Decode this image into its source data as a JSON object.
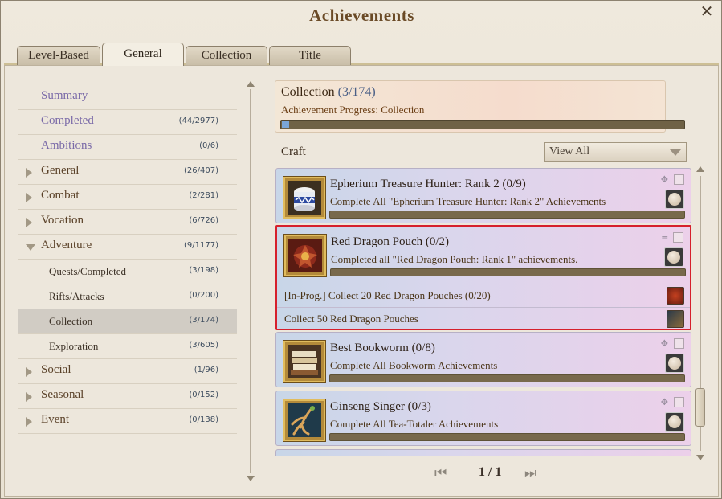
{
  "window": {
    "title": "Achievements",
    "close_glyph": "✕"
  },
  "tabs": [
    {
      "label": "Level-Based"
    },
    {
      "label": "General"
    },
    {
      "label": "Collection"
    },
    {
      "label": "Title"
    }
  ],
  "active_tab": "General",
  "nav": {
    "items": [
      {
        "label": "Summary",
        "count": ""
      },
      {
        "label": "Completed",
        "count": "(44/2977)"
      },
      {
        "label": "Ambitions",
        "count": "(0/6)"
      },
      {
        "label": "General",
        "count": "(26/407)"
      },
      {
        "label": "Combat",
        "count": "(2/281)"
      },
      {
        "label": "Vocation",
        "count": "(6/726)"
      },
      {
        "label": "Adventure",
        "count": "(9/1177)"
      },
      {
        "label": "Quests/Completed",
        "count": "(3/198)"
      },
      {
        "label": "Rifts/Attacks",
        "count": "(0/200)"
      },
      {
        "label": "Collection",
        "count": "(3/174)"
      },
      {
        "label": "Exploration",
        "count": "(3/605)"
      },
      {
        "label": "Social",
        "count": "(1/96)"
      },
      {
        "label": "Seasonal",
        "count": "(0/152)"
      },
      {
        "label": "Event",
        "count": "(0/138)"
      }
    ],
    "selected": "Collection"
  },
  "header": {
    "title": "Collection",
    "count": "(3/174)",
    "subtitle": "Achievement Progress: Collection",
    "progress": 0.017
  },
  "filter": {
    "section": "Craft",
    "value": "View All"
  },
  "achievements": [
    {
      "title": "Epherium Treasure Hunter: Rank 2 (0/9)",
      "desc": "Complete All \"Epherium Treasure Hunter: Rank 2\" Achievements",
      "progress": 0
    },
    {
      "title": "Red Dragon Pouch (0/2)",
      "desc": "Completed all \"Red Dragon Pouch: Rank 1\" achievements.",
      "progress": 0,
      "steps": [
        {
          "text": "[In-Prog.] Collect 20 Red Dragon Pouches (0/20)"
        },
        {
          "text": "Collect 50 Red Dragon Pouches"
        }
      ]
    },
    {
      "title": "Best Bookworm (0/8)",
      "desc": "Complete All Bookworm Achievements",
      "progress": 0
    },
    {
      "title": "Ginseng Singer (0/3)",
      "desc": "Complete All Tea-Totaler Achievements",
      "progress": 0
    }
  ],
  "pager": {
    "label": "1 / 1"
  },
  "colors": {
    "title": "#6a4a26",
    "nav_plain": "#7a6aa8",
    "count": "#3e4d5f",
    "highlight": "#d6202c",
    "progress_fill": "#7aa6d8"
  }
}
